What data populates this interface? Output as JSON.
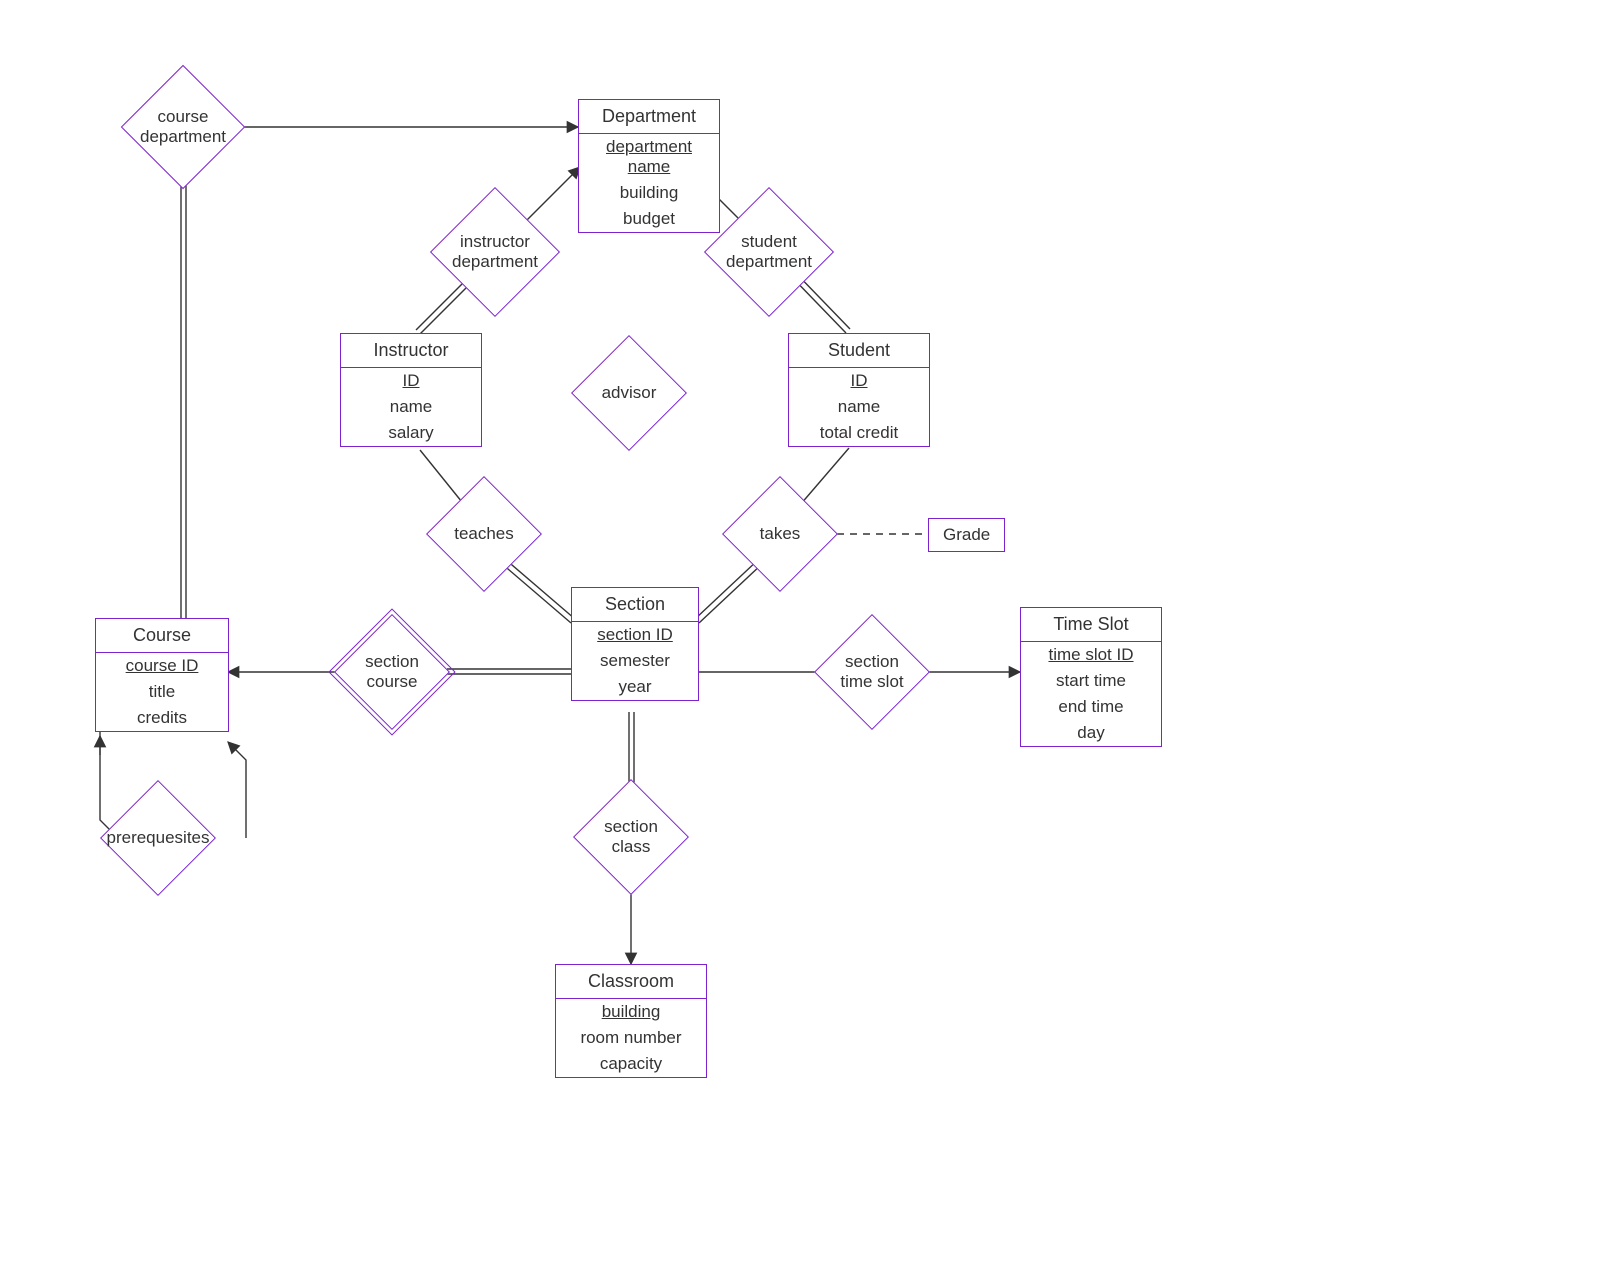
{
  "entities": {
    "department": {
      "title": "Department",
      "key": "department name",
      "a1": "building",
      "a2": "budget"
    },
    "instructor": {
      "title": "Instructor",
      "key": "ID",
      "a1": "name",
      "a2": "salary"
    },
    "student": {
      "title": "Student",
      "key": "ID",
      "a1": "name",
      "a2": "total credit"
    },
    "course": {
      "title": "Course",
      "key": "course ID",
      "a1": "title",
      "a2": "credits"
    },
    "section": {
      "title": "Section",
      "key": "section ID",
      "a1": "semester",
      "a2": "year"
    },
    "timeslot": {
      "title": "Time Slot",
      "key": "time slot ID",
      "a1": "start time",
      "a2": "end time",
      "a3": "day"
    },
    "classroom": {
      "title": "Classroom",
      "key": "building",
      "a1": "room number",
      "a2": "capacity"
    }
  },
  "relationships": {
    "course_department": "course\ndepartment",
    "instructor_department": "instructor\ndepartment",
    "student_department": "student\ndepartment",
    "advisor": "advisor",
    "teaches": "teaches",
    "takes": "takes",
    "section_course": "section\ncourse",
    "section_timeslot": "section\ntime slot",
    "section_class": "section\nclass",
    "prerequisites": "prerequesites"
  },
  "grade": "Grade"
}
